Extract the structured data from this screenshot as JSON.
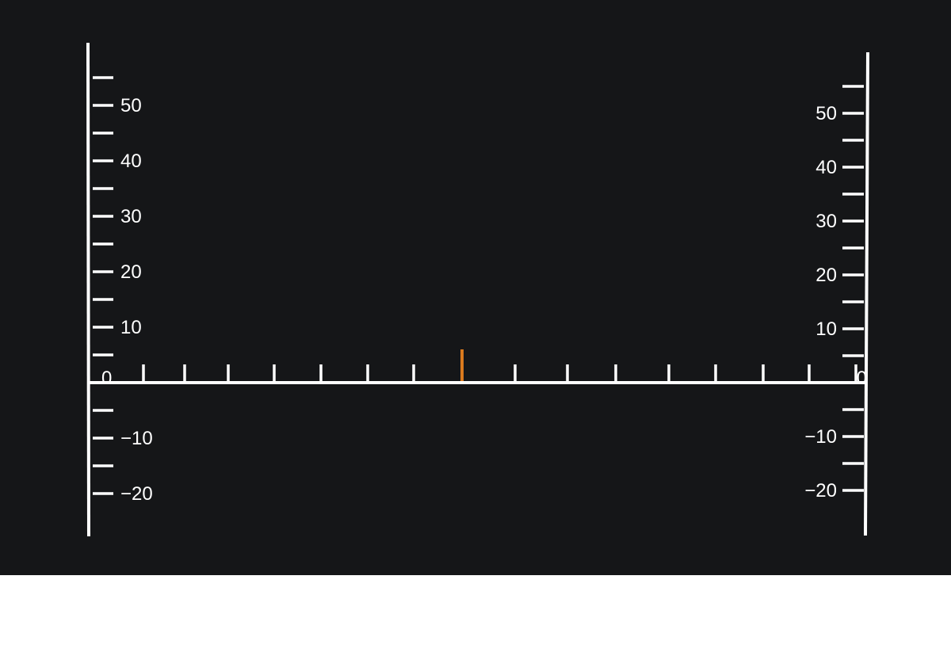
{
  "colors": {
    "background": "#151618",
    "ink": "#ffffff",
    "marker": "#d97a1e",
    "below": "#ffffff"
  },
  "left_scale": {
    "labels": [
      {
        "value": 50,
        "text": "50"
      },
      {
        "value": 40,
        "text": "40"
      },
      {
        "value": 30,
        "text": "30"
      },
      {
        "value": 20,
        "text": "20"
      },
      {
        "value": 10,
        "text": "10"
      },
      {
        "value": 0,
        "text": "0"
      },
      {
        "value": -10,
        "text": "−10"
      },
      {
        "value": -20,
        "text": "−20"
      }
    ]
  },
  "right_scale": {
    "labels": [
      {
        "value": 50,
        "text": "50"
      },
      {
        "value": 40,
        "text": "40"
      },
      {
        "value": 30,
        "text": "30"
      },
      {
        "value": 20,
        "text": "20"
      },
      {
        "value": 10,
        "text": "10"
      },
      {
        "value": 0,
        "text": "0"
      },
      {
        "value": -10,
        "text": "−10"
      },
      {
        "value": -20,
        "text": "−20"
      }
    ]
  },
  "horizontal_scale": {
    "tick_count": 16,
    "marker_tick_number": 8,
    "marker_color_name": "orange"
  }
}
